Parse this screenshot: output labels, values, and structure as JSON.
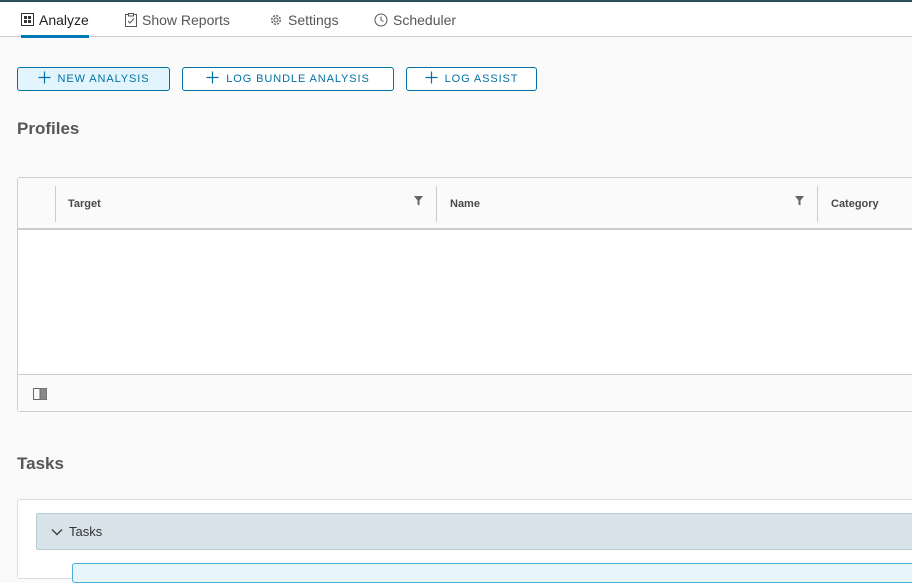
{
  "tabs": [
    {
      "label": "Analyze",
      "icon": "analyze-icon",
      "active": true
    },
    {
      "label": "Show Reports",
      "icon": "clipboard-icon",
      "active": false
    },
    {
      "label": "Settings",
      "icon": "gear-icon",
      "active": false
    },
    {
      "label": "Scheduler",
      "icon": "clock-icon",
      "active": false
    }
  ],
  "actions": {
    "new_analysis": "NEW ANALYSIS",
    "log_bundle_analysis": "LOG BUNDLE ANALYSIS",
    "log_assist": "LOG ASSIST"
  },
  "profiles": {
    "title": "Profiles",
    "columns": [
      "Target",
      "Name",
      "Category"
    ],
    "rows": []
  },
  "tasks": {
    "title": "Tasks",
    "stack_label": "Tasks"
  },
  "colors": {
    "accent": "#0072a3",
    "active_tab_underline": "#0079b8",
    "stack_header_bg": "#d7e3e8"
  }
}
